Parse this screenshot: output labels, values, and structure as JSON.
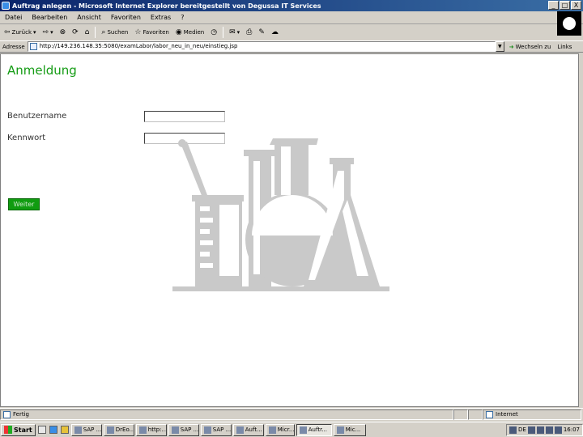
{
  "window": {
    "title": "Auftrag anlegen - Microsoft Internet Explorer bereitgestellt von Degussa IT Services",
    "controls": {
      "minimize": "_",
      "maximize": "□",
      "close": "X"
    }
  },
  "menu": [
    "Datei",
    "Bearbeiten",
    "Ansicht",
    "Favoriten",
    "Extras",
    "?"
  ],
  "toolbar": {
    "back": "Zurück",
    "search": "Suchen",
    "favorites": "Favoriten",
    "media": "Medien"
  },
  "address": {
    "label": "Adresse",
    "url": "http://149.236.148.35:5080/examLabor/labor_neu_in_neu/einstieg.jsp",
    "go_label": "Wechseln zu",
    "links_label": "Links"
  },
  "page": {
    "title": "Anmeldung",
    "username_label": "Benutzername",
    "password_label": "Kennwort",
    "username_value": "",
    "password_value": "",
    "submit_label": "Weiter"
  },
  "status": {
    "text": "Fertig",
    "zone": "Internet"
  },
  "taskbar": {
    "start_label": "Start",
    "tasks": [
      {
        "label": "SAP ...",
        "active": false
      },
      {
        "label": "DrEo...",
        "active": false
      },
      {
        "label": "http:...",
        "active": false
      },
      {
        "label": "SAP ...",
        "active": false
      },
      {
        "label": "SAP ...",
        "active": false
      },
      {
        "label": "Auft...",
        "active": false
      },
      {
        "label": "Micr...",
        "active": false
      },
      {
        "label": "Auftr...",
        "active": true
      },
      {
        "label": "Mic...",
        "active": false
      }
    ],
    "tray_lang": "DE",
    "clock": "16:07"
  },
  "colors": {
    "accent": "#159c15",
    "button": "#109c10",
    "titlebar": "#0a246a",
    "lab_art": "#c9c9c9"
  }
}
